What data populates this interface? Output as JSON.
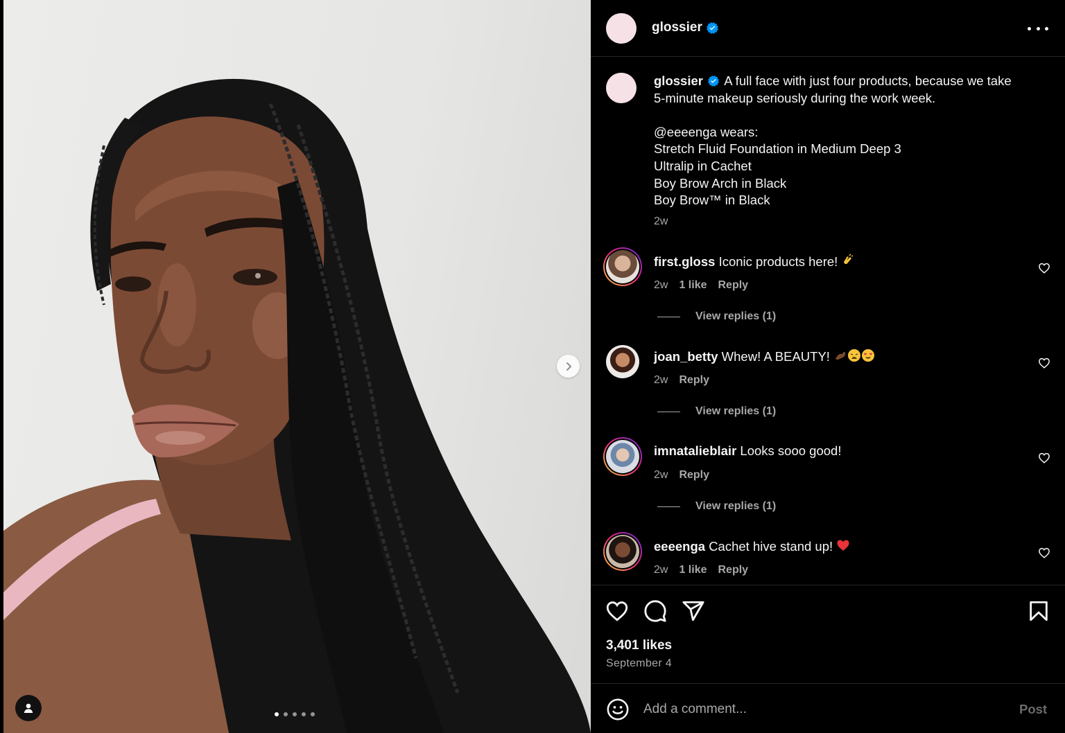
{
  "post": {
    "author": "glossier",
    "verified": true,
    "caption_lines": [
      "A full face with just four products, because we take",
      "5-minute makeup seriously during the work week.",
      "",
      "@eeeenga wears:",
      "Stretch Fluid Foundation in Medium Deep 3",
      "Ultralip in Cachet",
      "Boy Brow Arch in Black",
      "Boy Brow™ in Black"
    ],
    "caption_time": "2w",
    "likes": "3,401 likes",
    "date": "September 4"
  },
  "media": {
    "slide_count": 5,
    "active_slide": 1
  },
  "comments": [
    {
      "username": "first.gloss",
      "text": "Iconic products here!",
      "emoji": "clap",
      "time": "2w",
      "likes": "1 like",
      "reply": "Reply",
      "view_replies": "View replies (1)",
      "ring": true
    },
    {
      "username": "joan_betty",
      "text": "Whew! A BEAUTY!",
      "emoji": "flex-weary-heart-eyes",
      "time": "2w",
      "likes": "",
      "reply": "Reply",
      "view_replies": "View replies (1)",
      "ring": false
    },
    {
      "username": "imnatalieblair",
      "text": "Looks sooo good!",
      "emoji": "",
      "time": "2w",
      "likes": "",
      "reply": "Reply",
      "view_replies": "View replies (1)",
      "ring": true
    },
    {
      "username": "eeeenga",
      "text": "Cachet hive stand up!",
      "emoji": "red-heart",
      "time": "2w",
      "likes": "1 like",
      "reply": "Reply",
      "view_replies": "",
      "ring": true
    }
  ],
  "composer": {
    "placeholder": "Add a comment...",
    "post_label": "Post"
  },
  "colors": {
    "background": "#000000",
    "text": "#f5f5f5",
    "secondary_text": "#a8a8a8",
    "divider": "#262626",
    "verified_blue": "#0095f6",
    "avatar_pink": "#f5e1e6"
  },
  "icons": {
    "header_more": "more-horizontal-icon",
    "like": "heart-icon",
    "comment": "comment-bubble-icon",
    "share": "paper-plane-icon",
    "save": "bookmark-icon",
    "emoji_picker": "smiley-icon",
    "next": "chevron-right-icon",
    "tagged_user": "person-icon"
  }
}
